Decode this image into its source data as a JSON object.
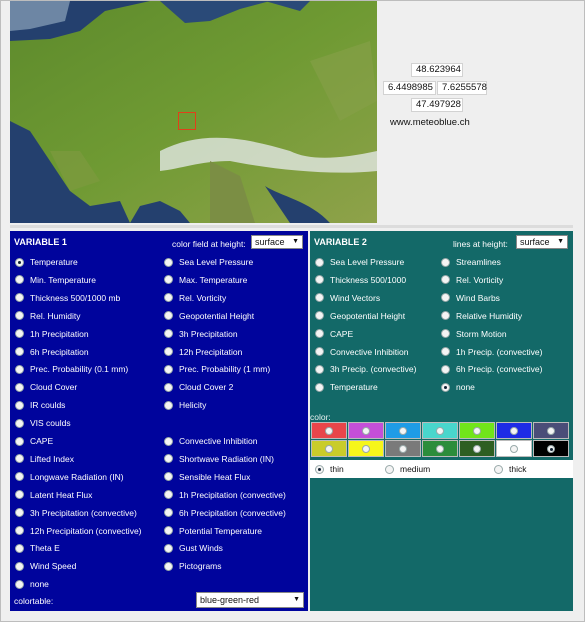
{
  "map": {
    "coords": {
      "north": "48.623964",
      "west": "6.4498985",
      "east": "7.6255578",
      "south": "47.497928"
    },
    "site": "www.meteoblue.ch"
  },
  "variable1": {
    "title": "VARIABLE 1",
    "height_label": "color field at height:",
    "height_value": "surface",
    "left_options": [
      {
        "label": "Temperature",
        "checked": true
      },
      {
        "label": "Min. Temperature"
      },
      {
        "label": "Thickness 500/1000 mb"
      },
      {
        "label": "Rel. Humidity"
      },
      {
        "label": "1h Precipitation"
      },
      {
        "label": "6h Precipitation"
      },
      {
        "label": "Prec. Probability (0.1 mm)"
      },
      {
        "label": "Cloud Cover"
      },
      {
        "label": "IR coulds"
      },
      {
        "label": "VIS coulds"
      },
      {
        "label": "CAPE"
      },
      {
        "label": "Lifted Index"
      },
      {
        "label": "Longwave Radiation (IN)"
      },
      {
        "label": "Latent Heat Flux"
      },
      {
        "label": "3h Precipitation (convective)"
      },
      {
        "label": "12h Precipitation (convective)"
      },
      {
        "label": "Theta E"
      },
      {
        "label": "Wind Speed"
      },
      {
        "label": "none"
      }
    ],
    "right_options": [
      {
        "label": "Sea Level Pressure",
        "row": 0
      },
      {
        "label": "Max. Temperature",
        "row": 1
      },
      {
        "label": "Rel. Vorticity",
        "row": 2
      },
      {
        "label": "Geopotential Height",
        "row": 3
      },
      {
        "label": "3h Precipitation",
        "row": 4
      },
      {
        "label": "12h Precipitation",
        "row": 5
      },
      {
        "label": "Prec. Probability (1 mm)",
        "row": 6
      },
      {
        "label": "Cloud Cover 2",
        "row": 7
      },
      {
        "label": "Helicity",
        "row": 8
      },
      {
        "label": "Convective Inhibition",
        "row": 10
      },
      {
        "label": "Shortwave Radiation (IN)",
        "row": 11
      },
      {
        "label": "Sensible Heat Flux",
        "row": 12
      },
      {
        "label": "1h Precipitation (convective)",
        "row": 13
      },
      {
        "label": "6h Precipitation (convective)",
        "row": 14
      },
      {
        "label": "Potential Temperature",
        "row": 15
      },
      {
        "label": "Gust Winds",
        "row": 16
      },
      {
        "label": "Pictograms",
        "row": 17
      }
    ],
    "colortable_label": "colortable:",
    "colortable_value": "blue-green-red"
  },
  "variable2": {
    "title": "VARIABLE 2",
    "height_label": "lines at height:",
    "height_value": "surface",
    "left_options": [
      {
        "label": "Sea Level Pressure"
      },
      {
        "label": "Thickness 500/1000"
      },
      {
        "label": "Wind Vectors"
      },
      {
        "label": "Geopotential Height"
      },
      {
        "label": "CAPE"
      },
      {
        "label": "Convective Inhibition"
      },
      {
        "label": "3h Precip. (convective)"
      },
      {
        "label": "Temperature"
      }
    ],
    "right_options": [
      {
        "label": "Streamlines"
      },
      {
        "label": "Rel. Vorticity"
      },
      {
        "label": "Wind Barbs"
      },
      {
        "label": "Relative Humidity"
      },
      {
        "label": "Storm Motion"
      },
      {
        "label": "1h Precip. (convective)"
      },
      {
        "label": "6h Precip. (convective)"
      },
      {
        "label": "none",
        "checked": true
      }
    ],
    "color_label": "color:",
    "swatches": [
      "#e8464a",
      "#c44fd8",
      "#1f9ce6",
      "#49d6cc",
      "#71e51a",
      "#1e2be6",
      "#4a4d78",
      "#c9cc2a",
      "#f6f61a",
      "#7a7a7a",
      "#2c8d3c",
      "#2e5f22",
      "#ffffff",
      "#000000"
    ],
    "selected_swatch": 13,
    "thickness": [
      {
        "label": "thin",
        "checked": true
      },
      {
        "label": "medium"
      },
      {
        "label": "thick"
      }
    ]
  }
}
